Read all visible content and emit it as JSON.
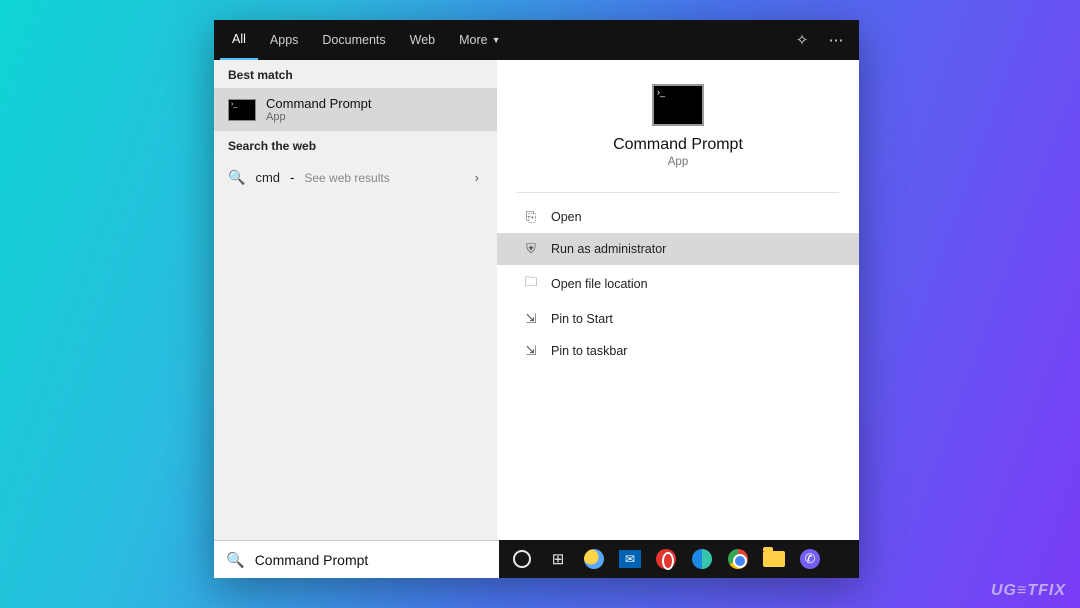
{
  "tabs": {
    "items": [
      "All",
      "Apps",
      "Documents",
      "Web",
      "More"
    ],
    "active_index": 0
  },
  "left": {
    "best_match_label": "Best match",
    "result": {
      "title": "Command Prompt",
      "subtitle": "App"
    },
    "web_label": "Search the web",
    "web_query": "cmd",
    "web_hint": "See web results"
  },
  "right": {
    "title": "Command Prompt",
    "subtitle": "App",
    "actions": [
      {
        "icon": "⎘",
        "label": "Open"
      },
      {
        "icon": "⛨",
        "label": "Run as administrator"
      },
      {
        "icon": "🗀",
        "label": "Open file location"
      },
      {
        "icon": "⇲",
        "label": "Pin to Start"
      },
      {
        "icon": "⇲",
        "label": "Pin to taskbar"
      }
    ],
    "selected_action_index": 1
  },
  "search": {
    "value": "Command Prompt"
  },
  "watermark": "UG≡TFIX"
}
